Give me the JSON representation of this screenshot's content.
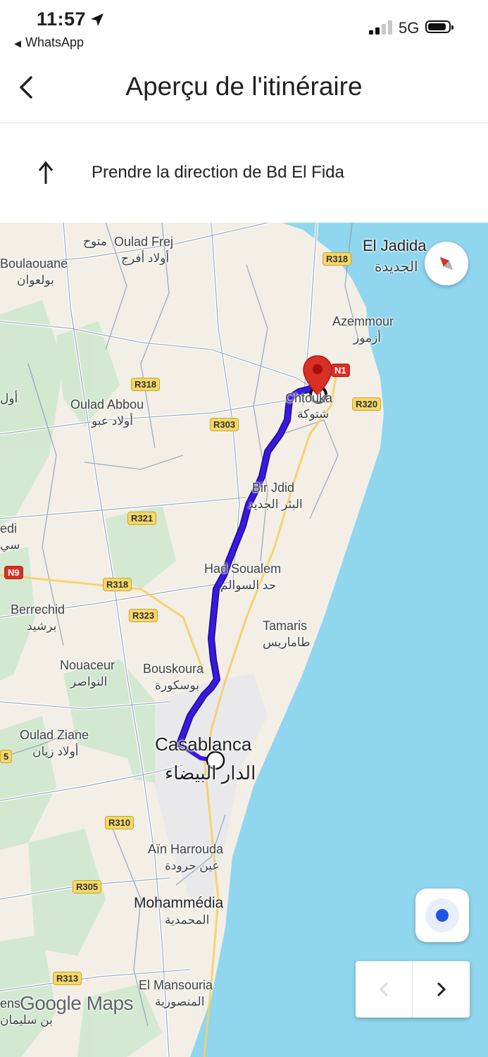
{
  "status_bar": {
    "time": "11:57",
    "back_app": "WhatsApp",
    "network": "5G"
  },
  "header": {
    "title": "Aperçu de l'itinéraire"
  },
  "step": {
    "instruction": "Prendre la direction de Bd El Fida"
  },
  "map": {
    "places": [
      {
        "name": "Oulad Frej",
        "arabic": "أولاد أفرج"
      },
      {
        "name": "Boulaouane",
        "arabic": "بولعوان"
      },
      {
        "name": "El Jadida",
        "arabic": "الجديدة"
      },
      {
        "name": "Azemmour",
        "arabic": "أزمور"
      },
      {
        "name": "Oulad Abbou",
        "arabic": "أولاد عبو"
      },
      {
        "name": "Chtouka",
        "arabic": "شتوكة"
      },
      {
        "name": "Bir Jdid",
        "arabic": "البئر الجديد"
      },
      {
        "name": "Had Soualem",
        "arabic": "حد السوالم"
      },
      {
        "name": "Berrechid",
        "arabic": "برشيد"
      },
      {
        "name": "Tamaris",
        "arabic": "طاماريس"
      },
      {
        "name": "Nouaceur",
        "arabic": "النواصر"
      },
      {
        "name": "Bouskoura",
        "arabic": "بوسكورة"
      },
      {
        "name": "Oulad Ziane",
        "arabic": "أولاد زيان"
      },
      {
        "name": "Casablanca",
        "arabic": "الدار البيضاء"
      },
      {
        "name": "Aïn Harrouda",
        "arabic": "عين حرودة"
      },
      {
        "name": "Mohammédia",
        "arabic": "المحمدية"
      },
      {
        "name": "El Mansouria",
        "arabic": "المنصورية"
      }
    ],
    "partial_labels": {
      "top_left_arabic": "متوح",
      "left_edge_1": "أول",
      "left_edge_2": "edi",
      "left_edge_3": "سي",
      "bottom_left": "ens",
      "bottom_left_arabic": "بن سليمان",
      "left_shield": "5"
    },
    "road_shields": [
      "R318",
      "R318",
      "R303",
      "R320",
      "N1",
      "R321",
      "N9",
      "R318",
      "R323",
      "R310",
      "R305",
      "R313"
    ],
    "logo": "Google Maps",
    "route_color": "#3a18e0",
    "water_color": "#8fd6ee",
    "pin_color": "#d93025"
  }
}
